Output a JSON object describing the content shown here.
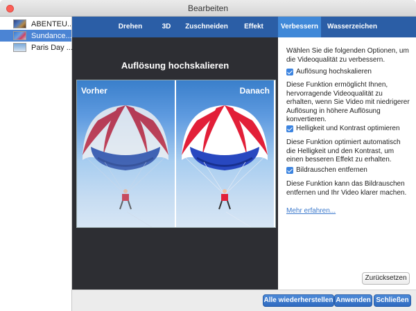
{
  "window": {
    "title": "Bearbeiten"
  },
  "sidebar": {
    "items": [
      {
        "label": "ABENTEU..."
      },
      {
        "label": "Sundance..."
      },
      {
        "label": "Paris Day ..."
      }
    ]
  },
  "tabs": [
    {
      "label": "Drehen"
    },
    {
      "label": "3D"
    },
    {
      "label": "Zuschneiden"
    },
    {
      "label": "Effekt"
    },
    {
      "label": "Verbessern"
    },
    {
      "label": "Wasserzeichen"
    }
  ],
  "preview": {
    "title": "Auflösung hochskalieren",
    "before_label": "Vorher",
    "after_label": "Danach"
  },
  "enhance": {
    "intro": "Wählen Sie die folgenden Optionen, um die Videoqualität zu verbessern.",
    "options": [
      {
        "label": "Auflösung hochskalieren",
        "checked": true,
        "description": "Diese Funktion ermöglicht Ihnen, hervorragende Videoqualität zu erhalten, wenn Sie Video mit niedrigerer Auflösung in höhere Auflösung konvertieren."
      },
      {
        "label": "Helligkeit und Kontrast optimieren",
        "checked": true,
        "description": "Diese Funktion optimiert automatisch die Helligkeit und den Kontrast, um einen besseren Effekt zu erhalten."
      },
      {
        "label": "Bildrauschen entfernen",
        "checked": true,
        "description": "Diese Funktion kann das Bildrauschen entfernen und Ihr Video klarer machen."
      }
    ],
    "learn_more": "Mehr erfahren...",
    "reset_button": "Zurücksetzen"
  },
  "footer": {
    "restore_all": "Alle wiederherstellen",
    "apply": "Anwenden",
    "close": "Schließen"
  },
  "colors": {
    "tab_bar": "#2b5ea6",
    "tab_active": "#3f88d8",
    "preview_bg": "#2d2e33",
    "selection": "#4b84d4"
  }
}
